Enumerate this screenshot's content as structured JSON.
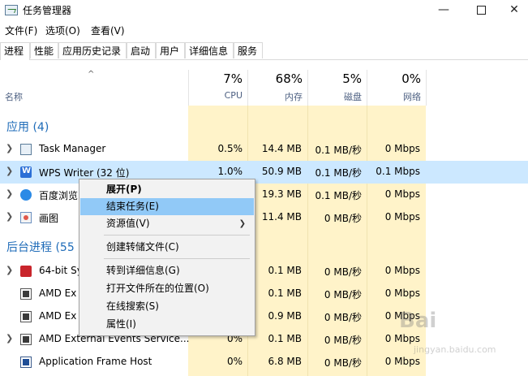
{
  "window": {
    "title": "任务管理器"
  },
  "menu": [
    "文件(F)",
    "选项(O)",
    "查看(V)"
  ],
  "tabs": [
    "进程",
    "性能",
    "应用历史记录",
    "启动",
    "用户",
    "详细信息",
    "服务"
  ],
  "columns": {
    "name_label": "名称",
    "cpu": {
      "pct": "7%",
      "label": "CPU"
    },
    "memory": {
      "pct": "68%",
      "label": "内存"
    },
    "disk": {
      "pct": "5%",
      "label": "磁盘"
    },
    "network": {
      "pct": "0%",
      "label": "网络"
    }
  },
  "groups": {
    "apps": "应用 (4)",
    "background": "后台进程 (55"
  },
  "rows": [
    {
      "name": "Task Manager",
      "cpu": "0.5%",
      "mem": "14.4 MB",
      "disk": "0.1 MB/秒",
      "net": "0 Mbps"
    },
    {
      "name": "WPS Writer (32 位)",
      "cpu": "1.0%",
      "mem": "50.9 MB",
      "disk": "0.1 MB/秒",
      "net": "0.1 Mbps"
    },
    {
      "name": "百度浏览",
      "cpu": "",
      "mem": "19.3 MB",
      "disk": "0.1 MB/秒",
      "net": "0 Mbps"
    },
    {
      "name": "画图",
      "cpu": "",
      "mem": "11.4 MB",
      "disk": "0 MB/秒",
      "net": "0 Mbps"
    },
    {
      "name": "64-bit Sy",
      "cpu": "",
      "mem": "0.1 MB",
      "disk": "0 MB/秒",
      "net": "0 Mbps"
    },
    {
      "name": "AMD Ex",
      "cpu": "",
      "mem": "0.1 MB",
      "disk": "0 MB/秒",
      "net": "0 Mbps"
    },
    {
      "name": "AMD Ex",
      "cpu": "",
      "mem": "0.9 MB",
      "disk": "0 MB/秒",
      "net": "0 Mbps"
    },
    {
      "name": "AMD External Events Service...",
      "cpu": "0%",
      "mem": "0.1 MB",
      "disk": "0 MB/秒",
      "net": "0 Mbps"
    },
    {
      "name": "Application Frame Host",
      "cpu": "0%",
      "mem": "6.8 MB",
      "disk": "0 MB/秒",
      "net": "0 Mbps"
    }
  ],
  "context_menu": [
    "展开(P)",
    "结束任务(E)",
    "资源值(V)",
    "创建转储文件(C)",
    "转到详细信息(G)",
    "打开文件所在的位置(O)",
    "在线搜索(S)",
    "属性(I)"
  ],
  "watermark": {
    "text": "Bai",
    "sub": "jingyan.baidu.com"
  },
  "icons": {
    "app": "task-manager-icon",
    "minimize": "minimize-icon",
    "maximize": "maximize-icon",
    "close": "close-icon",
    "sort": "sort-up-icon",
    "expand": "chevron-right-icon",
    "submenu": "chevron-right-icon"
  },
  "colors": {
    "group_title": "#1e6bb8",
    "column_bg": "#fff3c9",
    "selected_row": "#cce8ff",
    "menu_highlight": "#91c9f7"
  }
}
